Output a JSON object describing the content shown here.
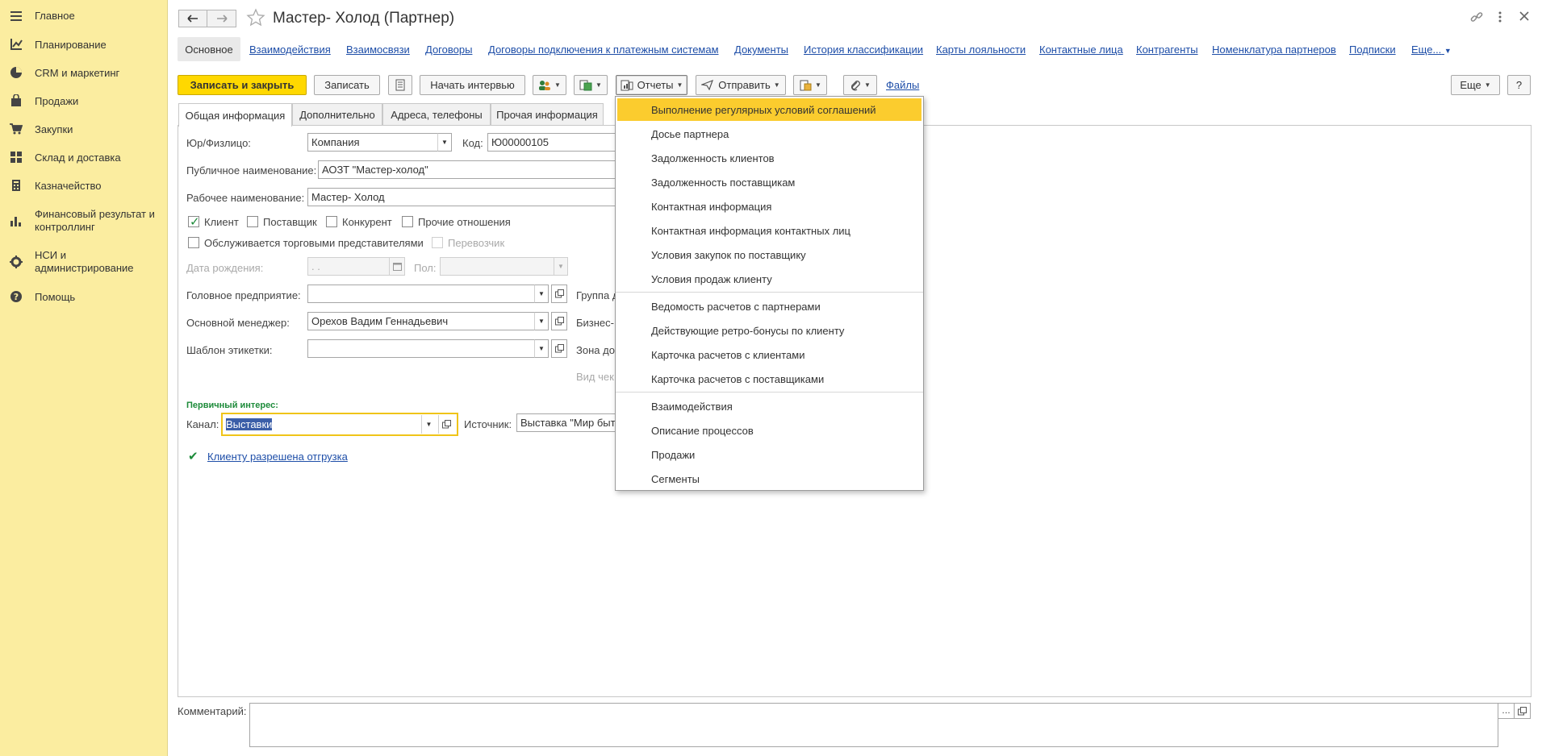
{
  "sidebar": {
    "items": [
      {
        "label": "Главное",
        "icon": "menu-icon"
      },
      {
        "label": "Планирование",
        "icon": "planning-icon"
      },
      {
        "label": "CRM и маркетинг",
        "icon": "pie-chart-icon"
      },
      {
        "label": "Продажи",
        "icon": "bag-icon"
      },
      {
        "label": "Закупки",
        "icon": "cart-icon"
      },
      {
        "label": "Склад и доставка",
        "icon": "warehouse-icon"
      },
      {
        "label": "Казначейство",
        "icon": "treasury-icon"
      },
      {
        "label": "Финансовый результат и контроллинг",
        "icon": "bar-chart-icon"
      },
      {
        "label": "НСИ и администрирование",
        "icon": "gear-icon"
      },
      {
        "label": "Помощь",
        "icon": "help-icon"
      }
    ]
  },
  "header": {
    "title": "Мастер- Холод (Партнер)"
  },
  "link_tabs": [
    {
      "label": "Основное"
    },
    {
      "label": "Взаимодействия"
    },
    {
      "label": "Взаимосвязи"
    },
    {
      "label": "Договоры"
    },
    {
      "label": "Договоры подключения к платежным системам"
    },
    {
      "label": "Документы"
    },
    {
      "label": "История классификации"
    },
    {
      "label": "Карты лояльности"
    },
    {
      "label": "Контактные лица"
    },
    {
      "label": "Контрагенты"
    },
    {
      "label": "Номенклатура партнеров"
    },
    {
      "label": "Подписки"
    },
    {
      "label": "Еще..."
    }
  ],
  "toolbar": {
    "save_close": "Записать и закрыть",
    "save": "Записать",
    "start_interview": "Начать интервью",
    "reports": "Отчеты",
    "send": "Отправить",
    "files": "Файлы",
    "more": "Еще",
    "help": "?"
  },
  "form_tabs": [
    {
      "label": "Общая информация"
    },
    {
      "label": "Дополнительно"
    },
    {
      "label": "Адреса, телефоны"
    },
    {
      "label": "Прочая информация"
    }
  ],
  "form": {
    "legal_type_label": "Юр/Физлицо:",
    "legal_type_value": "Компания",
    "code_label": "Код:",
    "code_value": "Ю00000105",
    "public_name_label": "Публичное наименование:",
    "public_name_value": "АОЗТ \"Мастер-холод\"",
    "work_name_label": "Рабочее наименование:",
    "work_name_value": "Мастер- Холод",
    "cb_client": "Клиент",
    "cb_supplier": "Поставщик",
    "cb_competitor": "Конкурент",
    "cb_other": "Прочие отношения",
    "cb_trade_reps": "Обслуживается торговыми представителями",
    "cb_carrier": "Перевозчик",
    "birth_date_label": "Дата рождения:",
    "birth_date_value": " .  .",
    "gender_label": "Пол:",
    "head_company_label": "Головное предприятие:",
    "group_label": "Группа д",
    "manager_label": "Основной менеджер:",
    "manager_value": "Орехов Вадим Геннадьевич",
    "business_label": "Бизнес-",
    "label_template_label": "Шаблон этикетки:",
    "zone_label": "Зона до",
    "check_view_label": "Вид чек",
    "primary_interest": "Первичный интерес:",
    "channel_label": "Канал:",
    "channel_value": "Выставки",
    "source_label": "Источник:",
    "source_value": "Выставка \"Мир быто",
    "shipment_link": "Клиенту разрешена отгрузка",
    "comment_label": "Комментарий:"
  },
  "reports_menu": {
    "groups": [
      [
        "Выполнение регулярных условий соглашений",
        "Досье партнера",
        "Задолженность клиентов",
        "Задолженность поставщикам",
        "Контактная информация",
        "Контактная информация контактных лиц",
        "Условия закупок по поставщику",
        "Условия продаж клиенту"
      ],
      [
        "Ведомость расчетов с партнерами",
        "Действующие ретро-бонусы по клиенту",
        "Карточка расчетов с клиентами",
        "Карточка расчетов с поставщиками"
      ],
      [
        "Взаимодействия",
        "Описание процессов",
        "Продажи",
        "Сегменты"
      ]
    ]
  },
  "colors": {
    "sidebar_bg": "#fbeda0",
    "accent_yellow": "#ffd800",
    "menu_highlight": "#fbcc2e",
    "link_blue": "#1e4ea8",
    "green": "#1d8b3a"
  }
}
